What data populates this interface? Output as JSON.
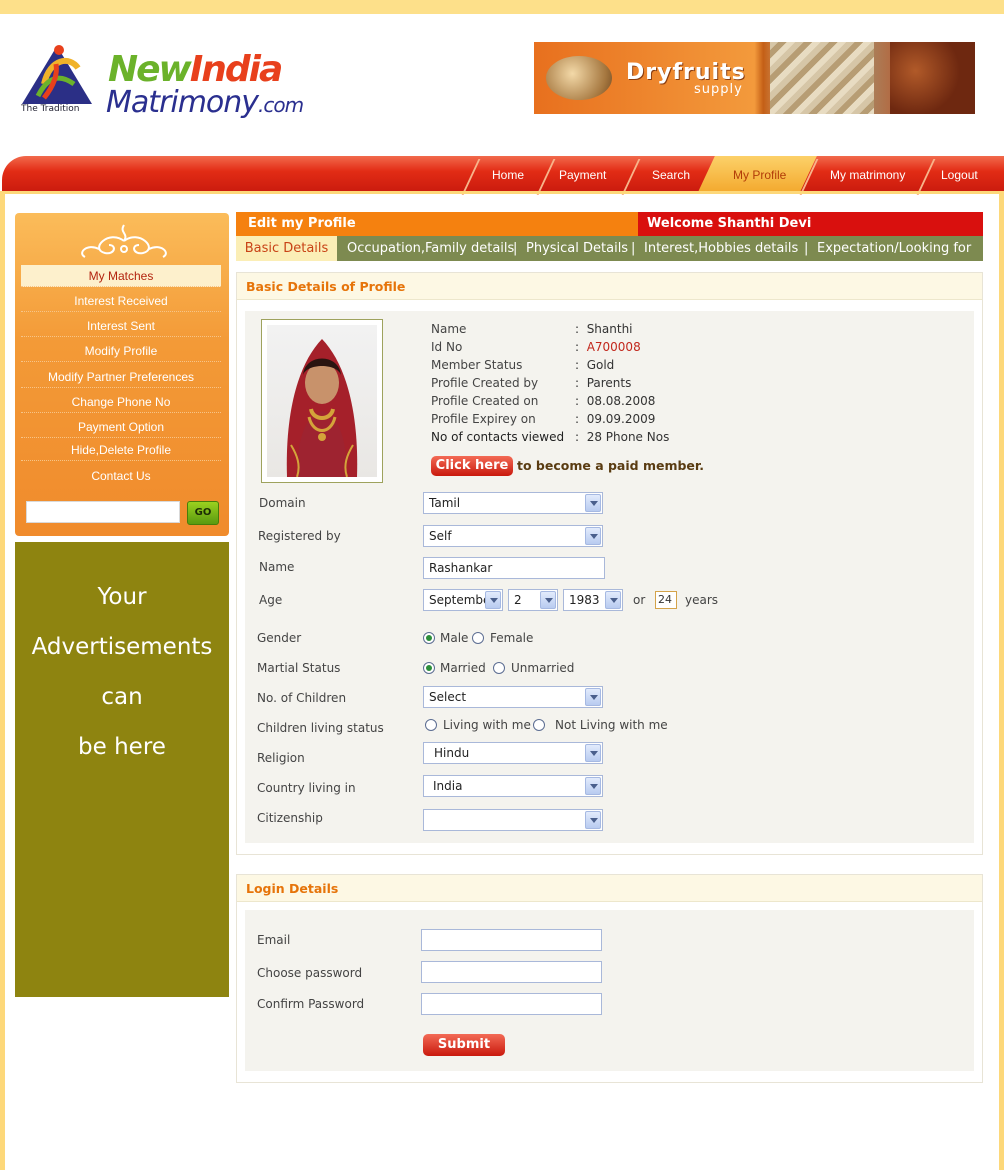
{
  "header": {
    "logo": {
      "line1_new": "New",
      "line1_india": "India",
      "line2": "Matrimony",
      "line2_com": ".com",
      "tagline": "The Tradition"
    },
    "banner": {
      "title": "Dryfruits",
      "subtitle": "supply"
    }
  },
  "nav": {
    "items": [
      "Home",
      "Payment",
      "Search",
      "My Profile",
      "My matrimony",
      "Logout"
    ],
    "active": "My Profile"
  },
  "sidebar": {
    "menu": [
      "My Matches",
      "Interest Received",
      "Interest Sent",
      "Modify Profile",
      "Modify Partner Preferences",
      "Change Phone No",
      "Payment Option",
      "Hide,Delete Profile",
      "Contact Us"
    ],
    "search_value": "",
    "go_label": "GO",
    "ad_lines": [
      "Your",
      "Advertisements",
      "can",
      "be here"
    ]
  },
  "profile_header": {
    "edit_title": "Edit my Profile",
    "welcome": "Welcome Shanthi Devi"
  },
  "tabs": {
    "active": "Basic Details",
    "items": [
      "Occupation,Family details",
      "Physical Details",
      "Interest,Hobbies details",
      "Expectation/Looking for"
    ],
    "separator": "|"
  },
  "basic": {
    "section_title": "Basic Details of Profile",
    "info": [
      {
        "label": "Name",
        "value": "Shanthi"
      },
      {
        "label": "Id No",
        "value": "A700008"
      },
      {
        "label": "Member Status",
        "value": "Gold"
      },
      {
        "label": "Profile Created by",
        "value": "Parents"
      },
      {
        "label": "Profile Created on",
        "value": "08.08.2008"
      },
      {
        "label": "Profile Expirey on",
        "value": "09.09.2009"
      },
      {
        "label": "No of contacts viewed",
        "value": "28 Phone Nos"
      }
    ],
    "colon": ":",
    "click_here": "Click here",
    "click_text": "to become a paid member.",
    "fields": {
      "domain": {
        "label": "Domain",
        "value": "Tamil"
      },
      "registered_by": {
        "label": "Registered by",
        "value": "Self"
      },
      "name": {
        "label": "Name",
        "value": "Rashankar"
      },
      "age": {
        "label": "Age",
        "month": "Septembe",
        "day": "2",
        "year": "1983",
        "or": "or",
        "years_value": "24",
        "years": "years"
      },
      "gender": {
        "label": "Gender",
        "options": [
          "Male",
          "Female"
        ],
        "selected": "Male"
      },
      "marital": {
        "label": "Martial Status",
        "options": [
          "Married",
          "Unmarried"
        ],
        "selected": "Married"
      },
      "children": {
        "label": "No. of Children",
        "value": "Select"
      },
      "children_living": {
        "label": "Children living status",
        "options": [
          "Living with me",
          "Not Living with me"
        ],
        "selected": ""
      },
      "religion": {
        "label": "Religion",
        "value": "Hindu"
      },
      "country": {
        "label": "Country living in",
        "value": "India"
      },
      "citizenship": {
        "label": "Citizenship",
        "value": ""
      }
    }
  },
  "login": {
    "section_title": "Login Details",
    "email_label": "Email",
    "password_label": "Choose password",
    "confirm_label": "Confirm Password",
    "email_value": "",
    "password_value": "",
    "confirm_value": "",
    "submit_label": "Submit"
  },
  "colors": {
    "nav_red": "#e22c15",
    "orange": "#f5810f",
    "tab_bg": "#7d8a50",
    "ad_bg": "#8e8410",
    "frame": "#fdd87a"
  }
}
